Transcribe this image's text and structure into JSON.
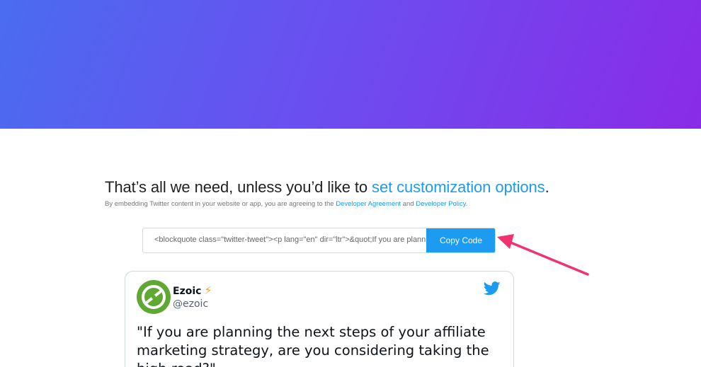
{
  "headline": {
    "text": "That’s all we need, unless you’d like to ",
    "link": "set customization options",
    "suffix": "."
  },
  "legal": {
    "prefix": "By embedding Twitter content in your website or app, you are agreeing to the ",
    "link1": "Developer Agreement",
    "middle": " and ",
    "link2": "Developer Policy",
    "suffix": "."
  },
  "code": {
    "value": "<blockquote class=\"twitter-tweet\"><p lang=\"en\" dir=\"ltr\">&quot;If you are planning the next steps",
    "button_label": "Copy Code"
  },
  "tweet": {
    "author_name": "Ezoic",
    "author_badge": "⚡",
    "handle": "@ezoic",
    "text": "\"If you are planning the next steps of your affiliate marketing strategy, are you considering taking the high road?\""
  },
  "colors": {
    "accent": "#1d9bf0",
    "arrow": "#f0326e",
    "hero_start": "#4a6cf0",
    "hero_end": "#8a2be8"
  }
}
